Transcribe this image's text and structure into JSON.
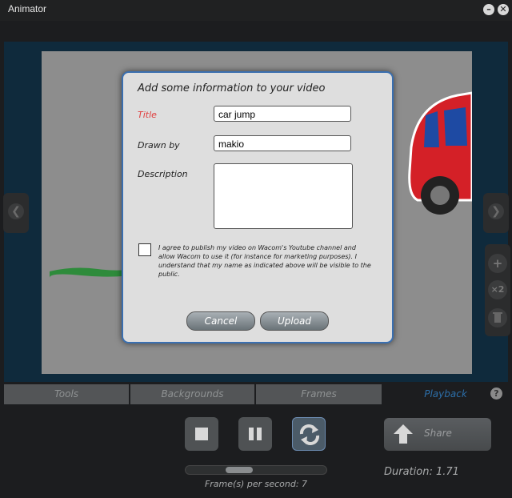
{
  "window": {
    "title": "Animator",
    "minimize_glyph": "–",
    "close_glyph": "✕"
  },
  "dialog": {
    "title": "Add some information to your video",
    "fields": {
      "title_label": "Title",
      "title_value": "car jump",
      "drawn_by_label": "Drawn by",
      "drawn_by_value": "makio",
      "description_label": "Description",
      "description_value": ""
    },
    "agreement_text": "I agree to publish my video on Wacom's Youtube channel and allow Wacom to use it (for instance for marketing purposes). I understand that my name as indicated above will be visible to the public.",
    "agreement_checked": false,
    "cancel_label": "Cancel",
    "upload_label": "Upload"
  },
  "tabs": [
    "Tools",
    "Backgrounds",
    "Frames",
    "Playback"
  ],
  "active_tab": "Playback",
  "help_glyph": "?",
  "side_tools": {
    "add": "+",
    "duplicate": "×2"
  },
  "playback": {
    "share_label": "Share",
    "fps_text": "Frame(s) per second: 7",
    "duration_text": "Duration: 1.71",
    "fps_slider_fraction": 0.35,
    "loop_enabled": true
  },
  "colors": {
    "accent": "#2c6ea8",
    "dialog_border": "#3a6fb0",
    "required_label": "#e03b3b",
    "tab_bg": "#535557",
    "stage_bg": "#0f2a3c"
  }
}
